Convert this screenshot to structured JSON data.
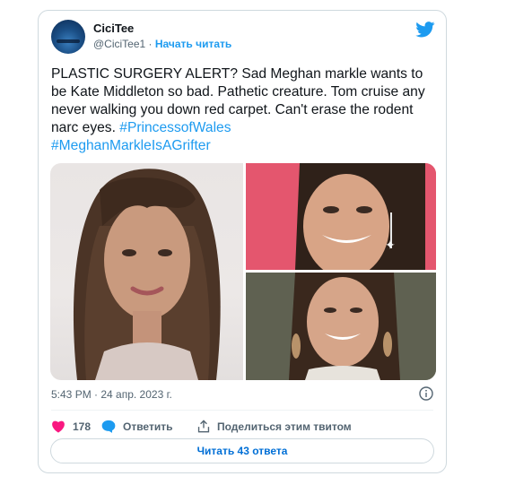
{
  "author": {
    "display_name": "CiciTee",
    "handle": "@CiciTee1",
    "separator": " · ",
    "follow_label": "Начать читать"
  },
  "tweet": {
    "text": "PLASTIC SURGERY ALERT? Sad Meghan markle wants to be Kate Middleton so bad. Pathetic creature.  Tom cruise any never walking you down red carpet. Can't erase the rodent narc eyes. ",
    "hashtags": [
      "#PrincessofWales",
      "#MeghanMarkleIsAGrifter"
    ],
    "timestamp": "5:43 PM · 24 апр. 2023 г."
  },
  "actions": {
    "likes_count": "178",
    "reply_label": "Ответить",
    "share_label": "Поделиться этим твитом"
  },
  "replies_button_label": "Читать 43 ответа",
  "colors": {
    "brand": "#1d9bf0",
    "like": "#f91880",
    "text_secondary": "#536471",
    "border": "#cfd9de"
  },
  "icons": [
    "twitter-bird-icon",
    "info-icon",
    "heart-icon",
    "reply-bubble-icon",
    "share-icon"
  ]
}
